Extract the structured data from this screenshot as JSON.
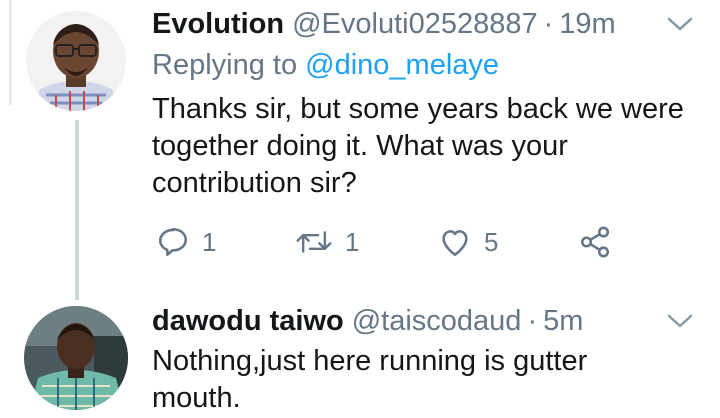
{
  "tweets": [
    {
      "display_name": "Evolution",
      "handle": "@Evoluti02528887",
      "separator": "·",
      "time": "19m",
      "replying_prefix": "Replying to",
      "replying_to": "@dino_melaye",
      "text": "Thanks sir, but some years back we were\ntogether doing it. What was your\ncontribution sir?",
      "reply_count": "1",
      "retweet_count": "1",
      "like_count": "5"
    },
    {
      "display_name": "dawodu taiwo",
      "handle": "@taiscodaud",
      "separator": "·",
      "time": "5m",
      "text": "Nothing,just here running is gutter\nmouth."
    }
  ],
  "icons": {
    "reply": "reply-icon",
    "retweet": "retweet-icon",
    "like": "heart-icon",
    "share": "share-icon",
    "more": "chevron-down-icon"
  },
  "colors": {
    "text": "#14171a",
    "secondary": "#657786",
    "link": "#1da1f2",
    "thread_line": "#ccd6dd"
  }
}
